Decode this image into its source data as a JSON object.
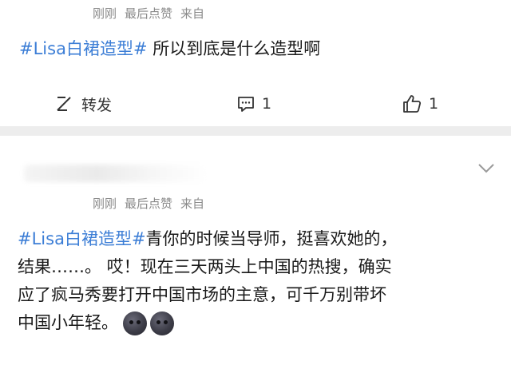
{
  "post1": {
    "meta": {
      "time": "刚刚",
      "liked_label": "最后点赞",
      "source": "来自"
    },
    "body": {
      "topic": "#Lisa白裙造型#",
      "text": " 所以到底是什么造型啊"
    },
    "actions": {
      "repost_label": "转发",
      "comment_count": "1",
      "like_count": "1"
    }
  },
  "post2": {
    "meta": {
      "time": "刚刚",
      "liked_label": "最后点赞",
      "source": "来自"
    },
    "body": {
      "topic": "#Lisa白裙造型#",
      "line1_text": "青你的时候当导师，挺喜欢她的，",
      "line2": "结果……。 哎！现在三天两头上中国的热搜，确实",
      "line3": "应了疯马秀要打开中国市场的主意，可千万别带坏",
      "line4": "中国小年轻。"
    },
    "emoji": [
      "new-moon-face",
      "new-moon-face"
    ]
  },
  "colors": {
    "topic": "#3c7ed6",
    "meta_text": "#8a8a8a",
    "divider": "#ededed"
  }
}
